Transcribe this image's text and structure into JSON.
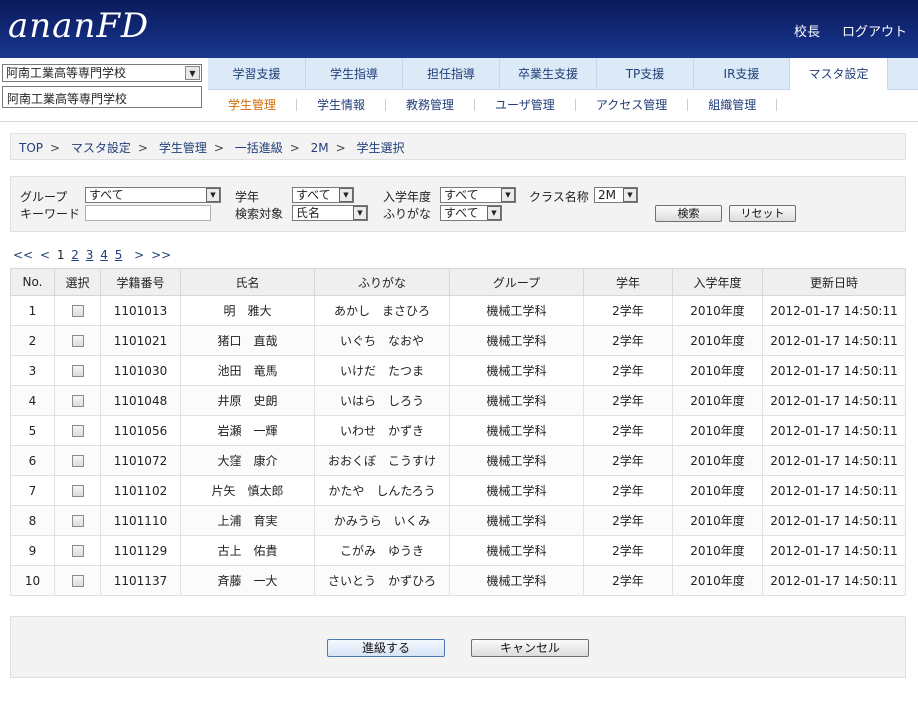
{
  "header": {
    "logo": "ananFD",
    "user_role": "校長",
    "logout": "ログアウト"
  },
  "school": {
    "selected": "阿南工業高等専門学校",
    "display": "阿南工業高等専門学校"
  },
  "tabs": [
    {
      "label": "学習支援"
    },
    {
      "label": "学生指導"
    },
    {
      "label": "担任指導"
    },
    {
      "label": "卒業生支援"
    },
    {
      "label": "TP支援"
    },
    {
      "label": "IR支援"
    },
    {
      "label": "マスタ設定"
    }
  ],
  "subnav": [
    {
      "label": "学生管理"
    },
    {
      "label": "学生情報"
    },
    {
      "label": "教務管理"
    },
    {
      "label": "ユーザ管理"
    },
    {
      "label": "アクセス管理"
    },
    {
      "label": "組織管理"
    }
  ],
  "breadcrumb": [
    "TOP",
    "マスタ設定",
    "学生管理",
    "一括進級",
    "2M",
    "学生選択"
  ],
  "search": {
    "group_label": "グループ",
    "group_value": "すべて",
    "keyword_label": "キーワード",
    "keyword_value": "",
    "grade_label": "学年",
    "grade_value": "すべて",
    "target_label": "検索対象",
    "target_value": "氏名",
    "enroll_label": "入学年度",
    "enroll_value": "すべて",
    "furigana_label": "ふりがな",
    "furigana_value": "すべて",
    "class_label": "クラス名称",
    "class_value": "2M",
    "search_button": "検索",
    "reset_button": "リセット"
  },
  "pager": {
    "first": "<<",
    "prev": "<",
    "current": "1",
    "pages": [
      "2",
      "3",
      "4",
      "5"
    ],
    "next": ">",
    "last": ">>"
  },
  "table": {
    "headers": [
      "No.",
      "選択",
      "学籍番号",
      "氏名",
      "ふりがな",
      "グループ",
      "学年",
      "入学年度",
      "更新日時"
    ],
    "rows": [
      {
        "no": "1",
        "id": "1101013",
        "name": "明　雅大",
        "kana": "あかし　まさひろ",
        "group": "機械工学科",
        "grade": "2学年",
        "enroll": "2010年度",
        "updated": "2012-01-17 14:50:11"
      },
      {
        "no": "2",
        "id": "1101021",
        "name": "猪口　直哉",
        "kana": "いぐち　なおや",
        "group": "機械工学科",
        "grade": "2学年",
        "enroll": "2010年度",
        "updated": "2012-01-17 14:50:11"
      },
      {
        "no": "3",
        "id": "1101030",
        "name": "池田　竜馬",
        "kana": "いけだ　たつま",
        "group": "機械工学科",
        "grade": "2学年",
        "enroll": "2010年度",
        "updated": "2012-01-17 14:50:11"
      },
      {
        "no": "4",
        "id": "1101048",
        "name": "井原　史朗",
        "kana": "いはら　しろう",
        "group": "機械工学科",
        "grade": "2学年",
        "enroll": "2010年度",
        "updated": "2012-01-17 14:50:11"
      },
      {
        "no": "5",
        "id": "1101056",
        "name": "岩瀬　一輝",
        "kana": "いわせ　かずき",
        "group": "機械工学科",
        "grade": "2学年",
        "enroll": "2010年度",
        "updated": "2012-01-17 14:50:11"
      },
      {
        "no": "6",
        "id": "1101072",
        "name": "大窪　康介",
        "kana": "おおくぼ　こうすけ",
        "group": "機械工学科",
        "grade": "2学年",
        "enroll": "2010年度",
        "updated": "2012-01-17 14:50:11"
      },
      {
        "no": "7",
        "id": "1101102",
        "name": "片矢　慎太郎",
        "kana": "かたや　しんたろう",
        "group": "機械工学科",
        "grade": "2学年",
        "enroll": "2010年度",
        "updated": "2012-01-17 14:50:11"
      },
      {
        "no": "8",
        "id": "1101110",
        "name": "上浦　育実",
        "kana": "かみうら　いくみ",
        "group": "機械工学科",
        "grade": "2学年",
        "enroll": "2010年度",
        "updated": "2012-01-17 14:50:11"
      },
      {
        "no": "9",
        "id": "1101129",
        "name": "古上　佑貴",
        "kana": "こがみ　ゆうき",
        "group": "機械工学科",
        "grade": "2学年",
        "enroll": "2010年度",
        "updated": "2012-01-17 14:50:11"
      },
      {
        "no": "10",
        "id": "1101137",
        "name": "斉藤　一大",
        "kana": "さいとう　かずひろ",
        "group": "機械工学科",
        "grade": "2学年",
        "enroll": "2010年度",
        "updated": "2012-01-17 14:50:11"
      }
    ]
  },
  "actions": {
    "promote": "進級する",
    "cancel": "キャンセル"
  },
  "colors": {
    "header_bg": "#122a7a",
    "link": "#22407a",
    "active_sub": "#d36a00",
    "tab_bg": "#dce9f7"
  }
}
